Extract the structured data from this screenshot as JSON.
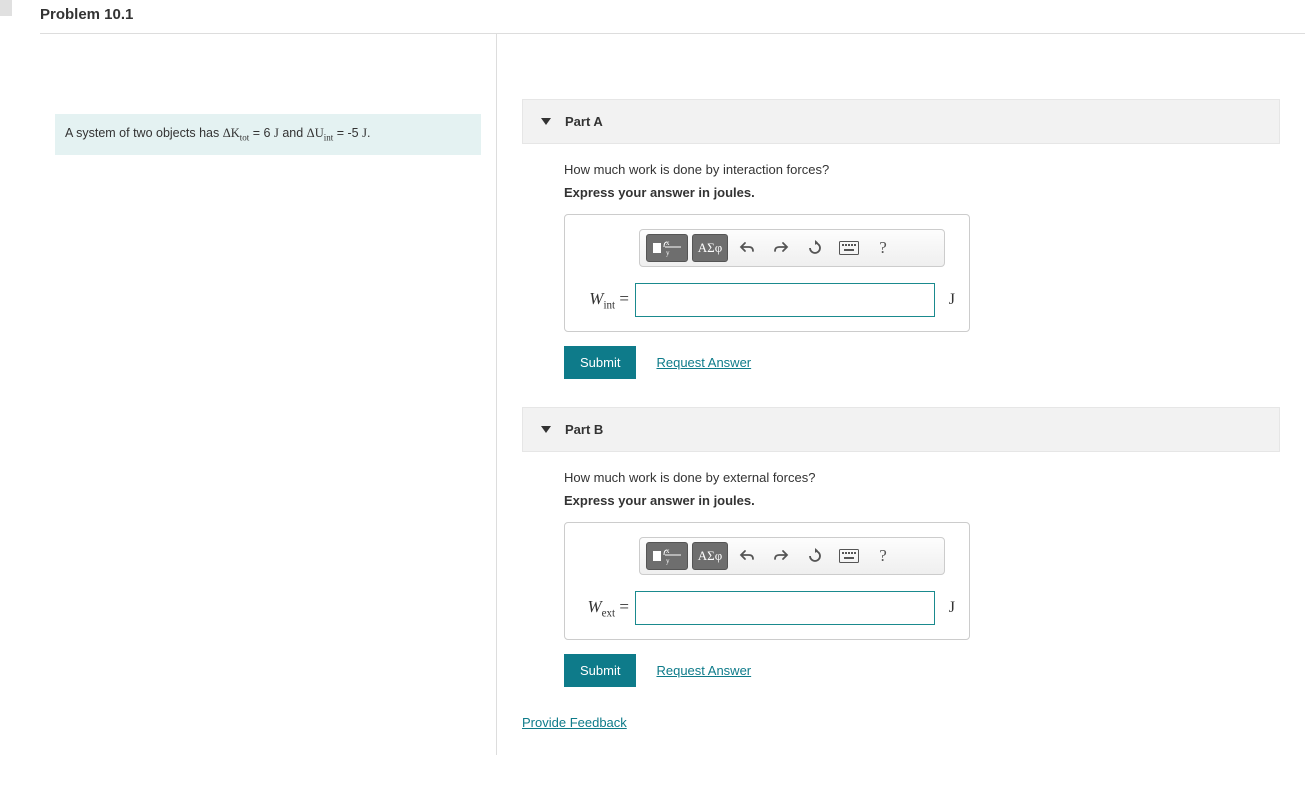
{
  "problem_title": "Problem 10.1",
  "prompt": {
    "prefix": "A system of two objects has ",
    "dk_sym": "ΔK",
    "dk_sub": "tot",
    "dk_eq": " = 6 ",
    "j1": "J",
    "mid": " and ",
    "du_sym": "ΔU",
    "du_sub": "int",
    "du_eq": " = -5 ",
    "j2": "J",
    "suffix": "."
  },
  "parts": [
    {
      "label": "Part A",
      "question": "How much work is done by interaction forces?",
      "instruction": "Express your answer in joules.",
      "var": "W",
      "var_sub": "int",
      "unit": "J"
    },
    {
      "label": "Part B",
      "question": "How much work is done by external forces?",
      "instruction": "Express your answer in joules.",
      "var": "W",
      "var_sub": "ext",
      "unit": "J"
    }
  ],
  "toolbar": {
    "greek": "ΑΣφ",
    "help": "?"
  },
  "buttons": {
    "submit": "Submit",
    "request": "Request Answer",
    "feedback": "Provide Feedback"
  }
}
